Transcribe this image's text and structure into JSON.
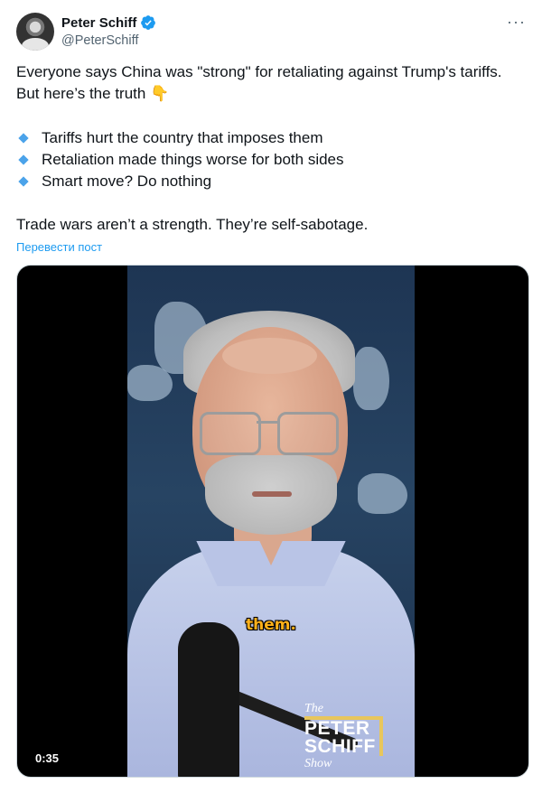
{
  "post": {
    "author_name": "Peter Schiff",
    "author_handle": "@PeterSchiff",
    "more_icon": "···",
    "intro_line1": "Everyone says China was \"strong\" for retaliating against Trump's tariffs.",
    "intro_line2": "But here’s the truth 👇",
    "bullets": [
      "Tariffs hurt the country that imposes them",
      "Retaliation made things worse for both sides",
      "Smart move? Do nothing"
    ],
    "closing": "Trade wars aren’t a strength. They’re self-sabotage.",
    "translate_label": "Перевести пост"
  },
  "video": {
    "caption": "them.",
    "duration": "0:35",
    "logo": {
      "the": "The",
      "line1": "PETER",
      "line2": "SCHIFF",
      "show": "Show"
    }
  },
  "colors": {
    "verified": "#1d9bf0",
    "link": "#1d9bf0",
    "bullet": "#4ba3ea"
  },
  "icons": {
    "verified": "verified-badge-icon",
    "more": "more-options-icon",
    "bullet": "diamond-bullet-icon",
    "pointing": "pointing-down-emoji"
  }
}
